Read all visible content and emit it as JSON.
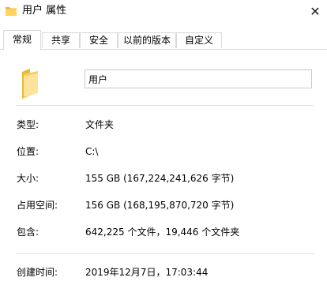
{
  "window": {
    "title": "用户 属性",
    "close_glyph": "✕"
  },
  "tabs": [
    {
      "label": "常规",
      "active": true
    },
    {
      "label": "共享",
      "active": false
    },
    {
      "label": "安全",
      "active": false
    },
    {
      "label": "以前的版本",
      "active": false
    },
    {
      "label": "自定义",
      "active": false
    }
  ],
  "general": {
    "folder_name": "用户",
    "rows": {
      "type": {
        "label": "类型:",
        "value": "文件夹"
      },
      "location": {
        "label": "位置:",
        "value": "C:\\"
      },
      "size": {
        "label": "大小:",
        "value": "155 GB (167,224,241,626 字节)"
      },
      "size_on_disk": {
        "label": "占用空间:",
        "value": "156 GB (168,195,870,720 字节)"
      },
      "contains": {
        "label": "包含:",
        "value": "642,225 个文件，19,446 个文件夹"
      },
      "created": {
        "label": "创建时间:",
        "value": "2019年12月7日，17:03:44"
      }
    }
  },
  "colors": {
    "folder_light": "#FFE9A2",
    "folder_dark": "#E8B934",
    "border": "#d9d9d9"
  }
}
